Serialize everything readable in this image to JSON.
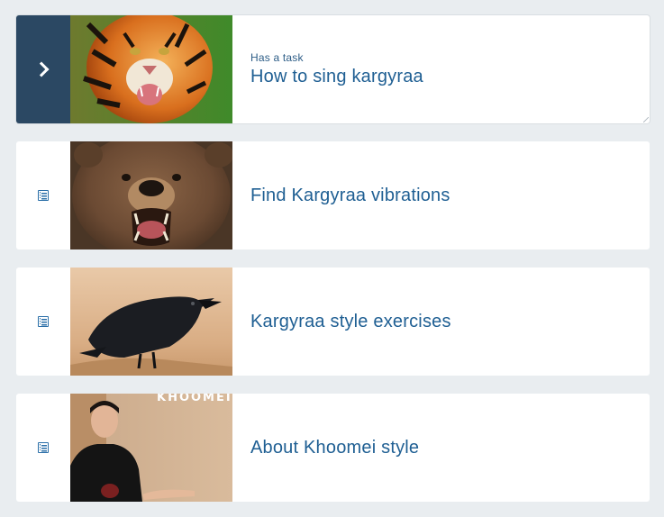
{
  "items": [
    {
      "eyebrow": "Has a task",
      "title": "How to sing kargyraa",
      "thumbnail": "tiger-photo",
      "icon": "chevron-right-icon",
      "active": true
    },
    {
      "eyebrow": "",
      "title": "Find Kargyraa vibrations",
      "thumbnail": "bear-photo",
      "icon": "document-icon",
      "active": false
    },
    {
      "eyebrow": "",
      "title": "Kargyraa style exercises",
      "thumbnail": "raven-photo",
      "icon": "document-icon",
      "active": false
    },
    {
      "eyebrow": "",
      "title": "About Khoomei style",
      "thumbnail": "man-presenting-photo",
      "thumbnail_text": "KHOOMEI",
      "icon": "document-icon",
      "active": false
    }
  ],
  "colors": {
    "background": "#e9edf0",
    "active_side": "#2b4863",
    "title": "#1f5f93",
    "icon": "#2b6fa8"
  }
}
